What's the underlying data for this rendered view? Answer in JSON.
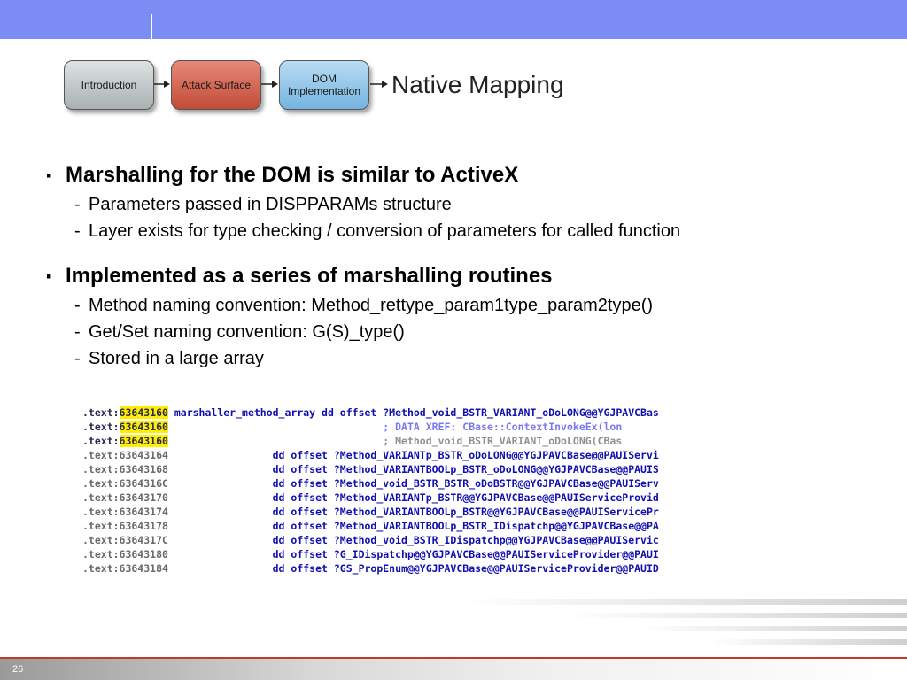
{
  "header": {
    "accent": "#7b8cf4"
  },
  "flow": {
    "steps": [
      "Introduction",
      "Attack Surface",
      "DOM Implementation"
    ],
    "step3_line1": "DOM",
    "step3_line2": "Implementation",
    "current": "Native Mapping"
  },
  "bullets": [
    {
      "text": "Marshalling for the DOM is similar to ActiveX",
      "subs": [
        "Parameters passed in DISPPARAMs structure",
        "Layer exists for type checking / conversion of parameters for called function"
      ]
    },
    {
      "text": "Implemented as a series of marshalling routines",
      "subs": [
        "Method naming convention: Method_rettype_param1type_param2type()",
        "Get/Set naming convention: G(S)_type()",
        "Stored in a large array"
      ]
    }
  ],
  "marker": "▪",
  "dash": "-",
  "code": {
    "lines": [
      {
        "pre": ".text:",
        "hl": "63643160",
        "rest": " marshaller_method_array dd offset ?Method_void_BSTR_VARIANT_oDoLONG@@YGJPAVCBas"
      },
      {
        "pre": ".text:",
        "hl": "63643160",
        "rest": "                                   ; DATA XREF: CBase::ContextInvokeEx(lon"
      },
      {
        "pre": ".text:",
        "hl": "63643160",
        "rest": "                                   ; Method_void_BSTR_VARIANT_oDoLONG(CBas"
      },
      {
        "pre": ".text:63643164",
        "hl": "",
        "rest": "                 dd offset ?Method_VARIANTp_BSTR_oDoLONG@@YGJPAVCBase@@PAUIServi"
      },
      {
        "pre": ".text:63643168",
        "hl": "",
        "rest": "                 dd offset ?Method_VARIANTBOOLp_BSTR_oDoLONG@@YGJPAVCBase@@PAUIS"
      },
      {
        "pre": ".text:6364316C",
        "hl": "",
        "rest": "                 dd offset ?Method_void_BSTR_BSTR_oDoBSTR@@YGJPAVCBase@@PAUIServ"
      },
      {
        "pre": ".text:63643170",
        "hl": "",
        "rest": "                 dd offset ?Method_VARIANTp_BSTR@@YGJPAVCBase@@PAUIServiceProvid"
      },
      {
        "pre": ".text:63643174",
        "hl": "",
        "rest": "                 dd offset ?Method_VARIANTBOOLp_BSTR@@YGJPAVCBase@@PAUIServicePr"
      },
      {
        "pre": ".text:63643178",
        "hl": "",
        "rest": "                 dd offset ?Method_VARIANTBOOLp_BSTR_IDispatchp@@YGJPAVCBase@@PA"
      },
      {
        "pre": ".text:6364317C",
        "hl": "",
        "rest": "                 dd offset ?Method_void_BSTR_IDispatchp@@YGJPAVCBase@@PAUIServic"
      },
      {
        "pre": ".text:63643180",
        "hl": "",
        "rest": "                 dd offset ?G_IDispatchp@@YGJPAVCBase@@PAUIServiceProvider@@PAUI"
      },
      {
        "pre": ".text:63643184",
        "hl": "",
        "rest": "                 dd offset ?GS_PropEnum@@YGJPAVCBase@@PAUIServiceProvider@@PAUID"
      }
    ]
  },
  "footer": {
    "page_number": "26",
    "line_color": "#c0392b"
  }
}
